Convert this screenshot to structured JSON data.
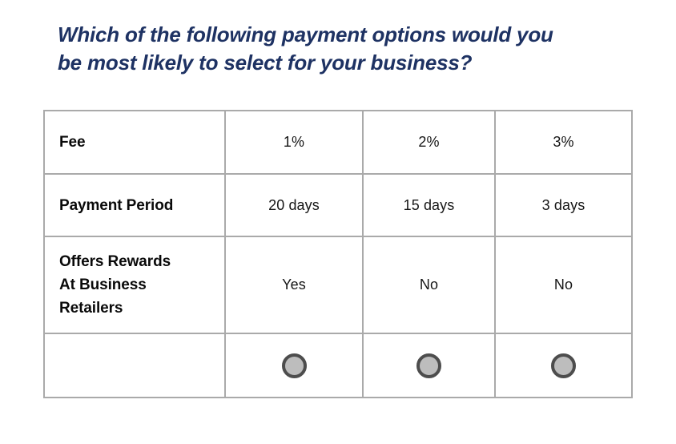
{
  "question": {
    "text": "Which of the following payment options would you\nbe most likely to select for your business?",
    "color": "#1e3263"
  },
  "table": {
    "rows": [
      {
        "label": "Fee",
        "values": [
          "1%",
          "2%",
          "3%"
        ]
      },
      {
        "label": "Payment Period",
        "values": [
          "20 days",
          "15 days",
          "3 days"
        ]
      },
      {
        "label": "Offers Rewards\nAt Business\nRetailers",
        "values": [
          "Yes",
          "No",
          "No"
        ]
      }
    ],
    "selection_row": {
      "label": "",
      "options": [
        {
          "name": "radio-option-1",
          "selected": false
        },
        {
          "name": "radio-option-2",
          "selected": false
        },
        {
          "name": "radio-option-3",
          "selected": false
        }
      ]
    },
    "border_color": "#aaaaaa",
    "radio_fill_color": "#bdbdbd",
    "radio_ring_color": "#4d4d4d"
  }
}
